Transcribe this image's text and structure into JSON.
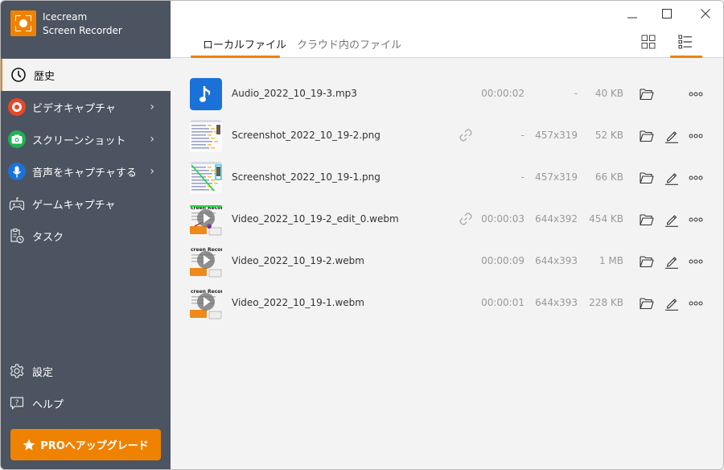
{
  "app": {
    "title_line1": "Icecream",
    "title_line2": "Screen Recorder",
    "accent_color": "#ef8200"
  },
  "sidebar": {
    "items": [
      {
        "label": "歴史",
        "icon": "clock-icon",
        "active": true
      },
      {
        "label": "ビデオキャプチャ",
        "icon": "record-icon",
        "submenu": true,
        "icon_color": "#e8462a"
      },
      {
        "label": "スクリーンショット",
        "icon": "camera-icon",
        "submenu": true,
        "icon_color": "#1fb254"
      },
      {
        "label": "音声をキャプチャする",
        "icon": "microphone-icon",
        "submenu": true,
        "icon_color": "#1a72d9"
      },
      {
        "label": "ゲームキャプチャ",
        "icon": "gamepad-icon"
      },
      {
        "label": "タスク",
        "icon": "task-clipboard-icon"
      }
    ],
    "bottom_items": [
      {
        "label": "設定",
        "icon": "gear-icon"
      },
      {
        "label": "ヘルプ",
        "icon": "help-icon"
      }
    ],
    "upgrade_label": "PROへアップグレード",
    "chevron": "›"
  },
  "header": {
    "tabs": [
      {
        "label": "ローカルファイル",
        "active": true
      },
      {
        "label": "クラウド内のファイル",
        "active": false
      }
    ],
    "view_modes": [
      "grid-view",
      "list-view"
    ],
    "active_view": "list-view"
  },
  "files": [
    {
      "name": "Audio_2022_10_19-3.mp3",
      "type": "audio",
      "linked": false,
      "duration": "00:00:02",
      "resolution": "-",
      "size": "40 KB",
      "editable": false
    },
    {
      "name": "Screenshot_2022_10_19-2.png",
      "type": "screenshot",
      "linked": true,
      "duration": "-",
      "resolution": "457x319",
      "size": "52 KB",
      "editable": true
    },
    {
      "name": "Screenshot_2022_10_19-1.png",
      "type": "screenshot",
      "linked": false,
      "duration": "-",
      "resolution": "457x319",
      "size": "66 KB",
      "editable": true
    },
    {
      "name": "Video_2022_10_19-2_edit_0.webm",
      "type": "video",
      "linked": true,
      "duration": "00:00:03",
      "resolution": "644x392",
      "size": "454 KB",
      "editable": true
    },
    {
      "name": "Video_2022_10_19-2.webm",
      "type": "video",
      "linked": false,
      "duration": "00:00:09",
      "resolution": "644x393",
      "size": "1 MB",
      "editable": true
    },
    {
      "name": "Video_2022_10_19-1.webm",
      "type": "video",
      "linked": false,
      "duration": "00:00:01",
      "resolution": "644x393",
      "size": "228 KB",
      "editable": true
    }
  ]
}
